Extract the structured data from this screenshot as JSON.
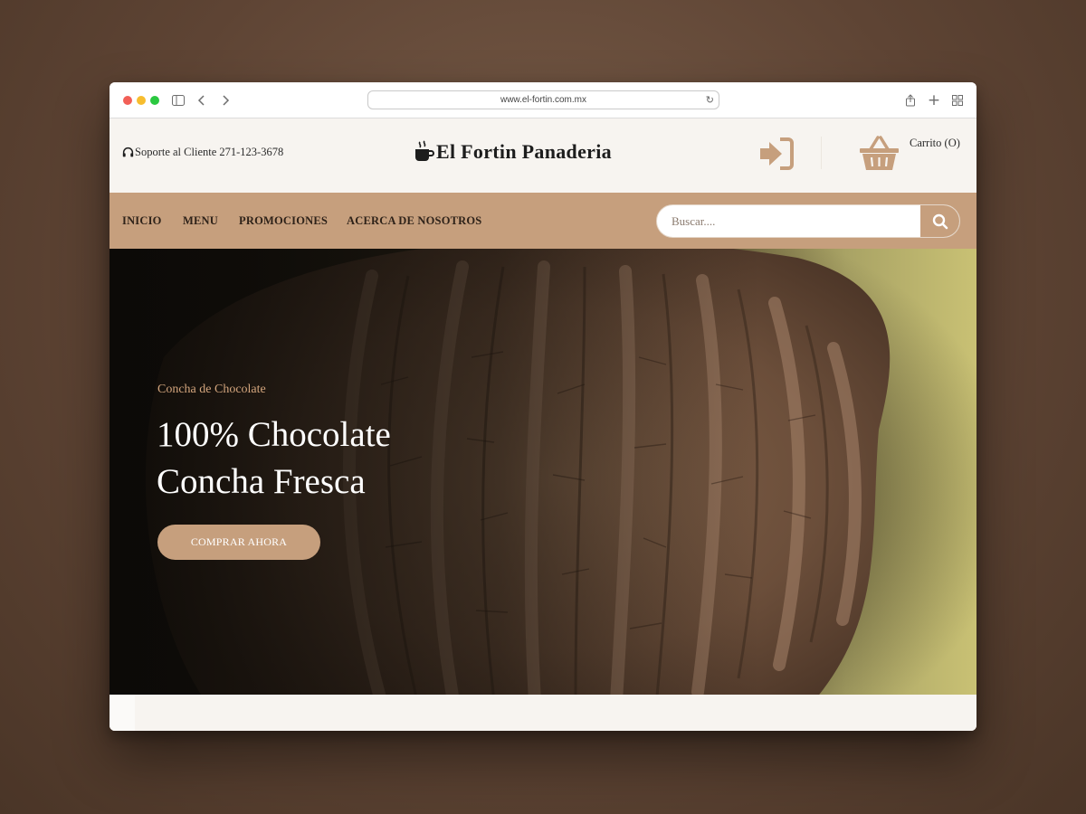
{
  "browser": {
    "url": "www.el-fortin.com.mx"
  },
  "header": {
    "support_text": "Soporte al Cliente 271-123-3678",
    "brand_name": "El Fortin Panaderia",
    "cart_label": "Carrito (O)"
  },
  "nav": {
    "items": [
      {
        "label": "INICIO"
      },
      {
        "label": "MENU"
      },
      {
        "label": "PROMOCIONES"
      },
      {
        "label": "ACERCA DE NOSOTROS"
      }
    ],
    "search_placeholder": "Buscar...."
  },
  "hero": {
    "subtitle": "Concha de Chocolate",
    "title_line1": "100% Chocolate",
    "title_line2": "Concha Fresca",
    "button_label": "COMPRAR AHORA"
  },
  "colors": {
    "accent": "#c69f7d",
    "accent_text": "#d3a57d",
    "page_bg": "#f7f4f0",
    "dark_text": "#1d1d1d"
  }
}
